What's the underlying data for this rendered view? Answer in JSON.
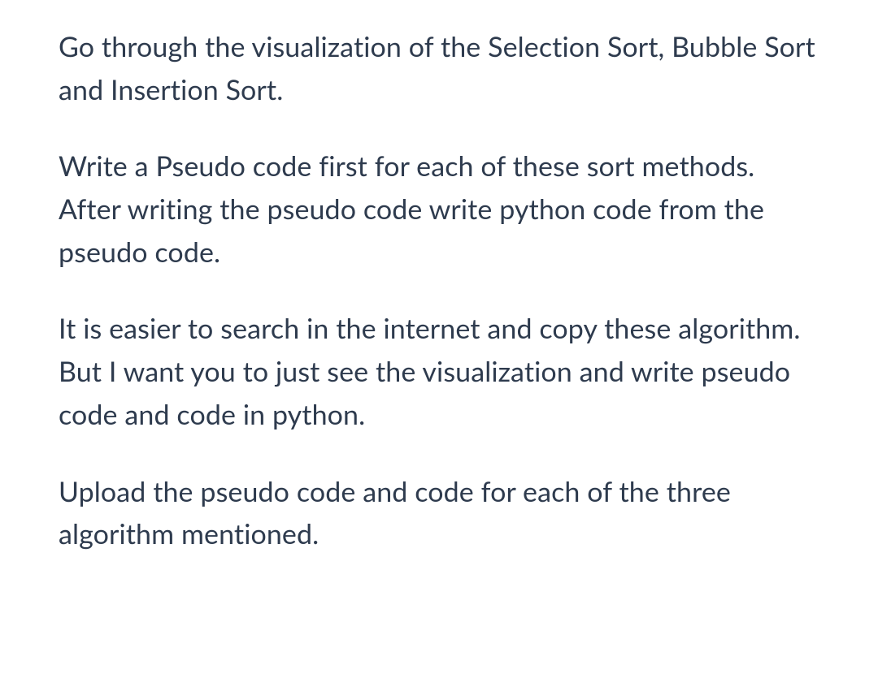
{
  "paragraphs": {
    "p1": "Go through the visualization of the Selection Sort, Bubble Sort and Insertion Sort.",
    "p2": "Write a Pseudo code first for each of these sort methods.  After writing the pseudo code write python code from the pseudo code.",
    "p3": "It is easier to search in the internet and copy these algorithm. But I want you to just see the visualization and write pseudo code and code in python.",
    "p4": "Upload the pseudo code and code for each of the three algorithm mentioned."
  }
}
